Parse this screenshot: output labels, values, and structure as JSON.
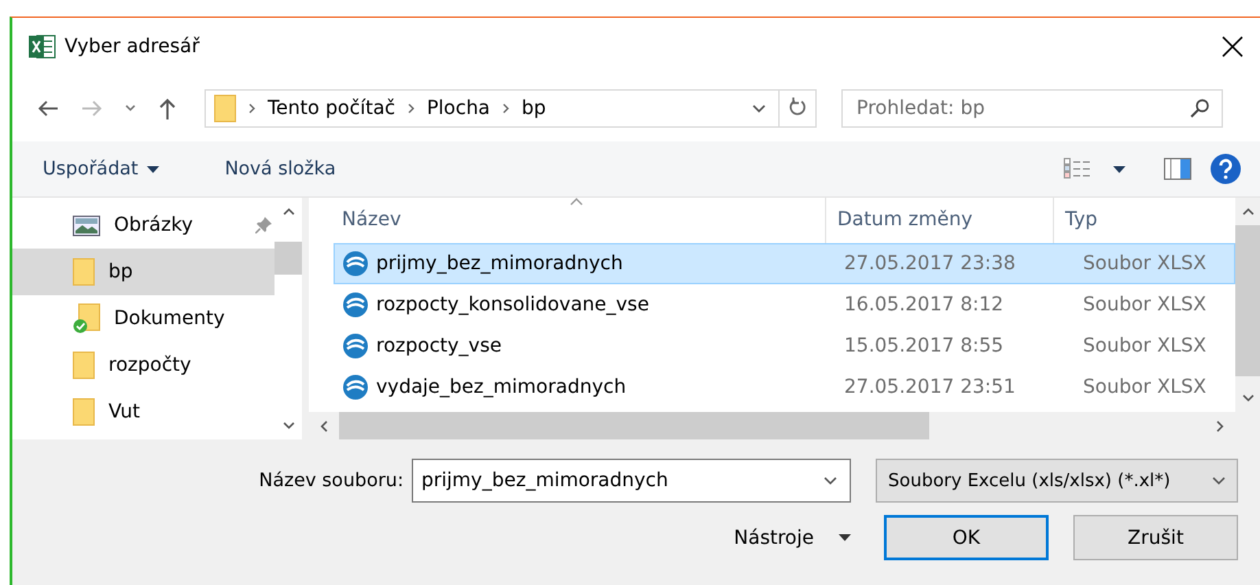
{
  "window": {
    "title": "Vyber adresář"
  },
  "breadcrumb": [
    "Tento počítač",
    "Plocha",
    "bp"
  ],
  "search": {
    "placeholder": "Prohledat: bp"
  },
  "toolbar": {
    "organize": "Uspořádat",
    "new_folder": "Nová složka"
  },
  "sidebar": {
    "items": [
      {
        "label": "Obrázky",
        "kind": "pictures",
        "pinned": true,
        "selected": false
      },
      {
        "label": "bp",
        "kind": "folder",
        "pinned": false,
        "selected": true
      },
      {
        "label": "Dokumenty",
        "kind": "synced",
        "pinned": false,
        "selected": false
      },
      {
        "label": "rozpočty",
        "kind": "folder",
        "pinned": false,
        "selected": false
      },
      {
        "label": "Vut",
        "kind": "folder",
        "pinned": false,
        "selected": false
      }
    ]
  },
  "table": {
    "columns": [
      "Název",
      "Datum změny",
      "Typ"
    ],
    "rows": [
      {
        "name": "prijmy_bez_mimoradnych",
        "date": "27.05.2017 23:38",
        "type": "Soubor XLSX",
        "selected": true
      },
      {
        "name": "rozpocty_konsolidovane_vse",
        "date": "16.05.2017 8:12",
        "type": "Soubor XLSX",
        "selected": false
      },
      {
        "name": "rozpocty_vse",
        "date": "15.05.2017 8:55",
        "type": "Soubor XLSX",
        "selected": false
      },
      {
        "name": "vydaje_bez_mimoradnych",
        "date": "27.05.2017 23:51",
        "type": "Soubor XLSX",
        "selected": false
      }
    ]
  },
  "filename": {
    "label": "Název souboru:",
    "value": "prijmy_bez_mimoradnych"
  },
  "filetype": "Soubory Excelu (xls/xlsx) (*.xl*)",
  "buttons": {
    "tools": "Nástroje",
    "ok": "OK",
    "cancel": "Zrušit"
  }
}
